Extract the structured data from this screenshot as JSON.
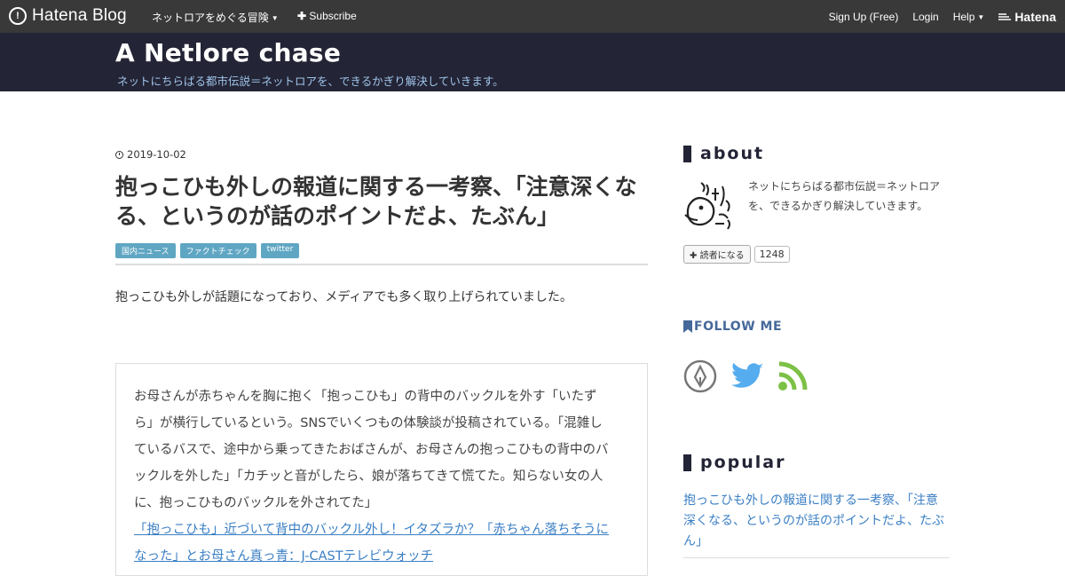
{
  "global_bar": {
    "brand": "Hatena Blog",
    "blog_menu": "ネットロアをめぐる冒険",
    "subscribe": "Subscribe",
    "signup": "Sign Up (Free)",
    "login": "Login",
    "help": "Help",
    "hatena": "Hatena"
  },
  "blog": {
    "title": "A Netlore chase",
    "description": "ネットにちらばる都市伝説＝ネットロアを、できるかぎり解決していきます。"
  },
  "entry": {
    "date": "2019-10-02",
    "title": "抱っこひも外しの報道に関する一考察、「注意深くなる、というのが話のポイントだよ、たぶん」",
    "categories": [
      "国内ニュース",
      "ファクトチェック",
      "twitter"
    ],
    "lead": "抱っこひも外しが話題になっており、メディアでも多く取り上げられていました。",
    "quote": {
      "lines": [
        "お母さんが赤ちゃんを胸に抱く「抱っこひも」の背中のバックルを外す「いたず",
        "ら」が横行しているという。SNSでいくつもの体験談が投稿されている。「混雑し",
        "ているバスで、途中から乗ってきたおばさんが、お母さんの抱っこひもの背中のバ",
        "ックルを外した」「カチッと音がしたら、娘が落ちてきて慌てた。知らない女の人",
        "に、抱っこひものバックルを外されてた」"
      ],
      "link_lines": [
        "「抱っこひも」近づいて背中のバックル外し！イタズラか？「赤ちゃん落ちそうに",
        "なった」とお母さん真っ青：J-CASTテレビウォッチ"
      ]
    }
  },
  "sidebar": {
    "about_heading": "about",
    "about_text": "ネットにちらばる都市伝説＝ネットロアを、できるかぎり解決していきます。",
    "reader_button": "読者になる",
    "reader_count": "1248",
    "follow_heading": "FOLLOW ME",
    "follow_icons": [
      "hatena-pen-icon",
      "twitter-icon",
      "rss-icon"
    ],
    "popular_heading": "popular",
    "popular_item": "抱っこひも外しの報道に関する一考察、「注意深くなる、というのが話のポイントだよ、たぶん」"
  },
  "colors": {
    "global_bar": "#393939",
    "blog_header": "#232435",
    "category_badge": "#5fa6c3",
    "link": "#3b7fc4",
    "twitter": "#55acee",
    "rss": "#7cc146"
  }
}
